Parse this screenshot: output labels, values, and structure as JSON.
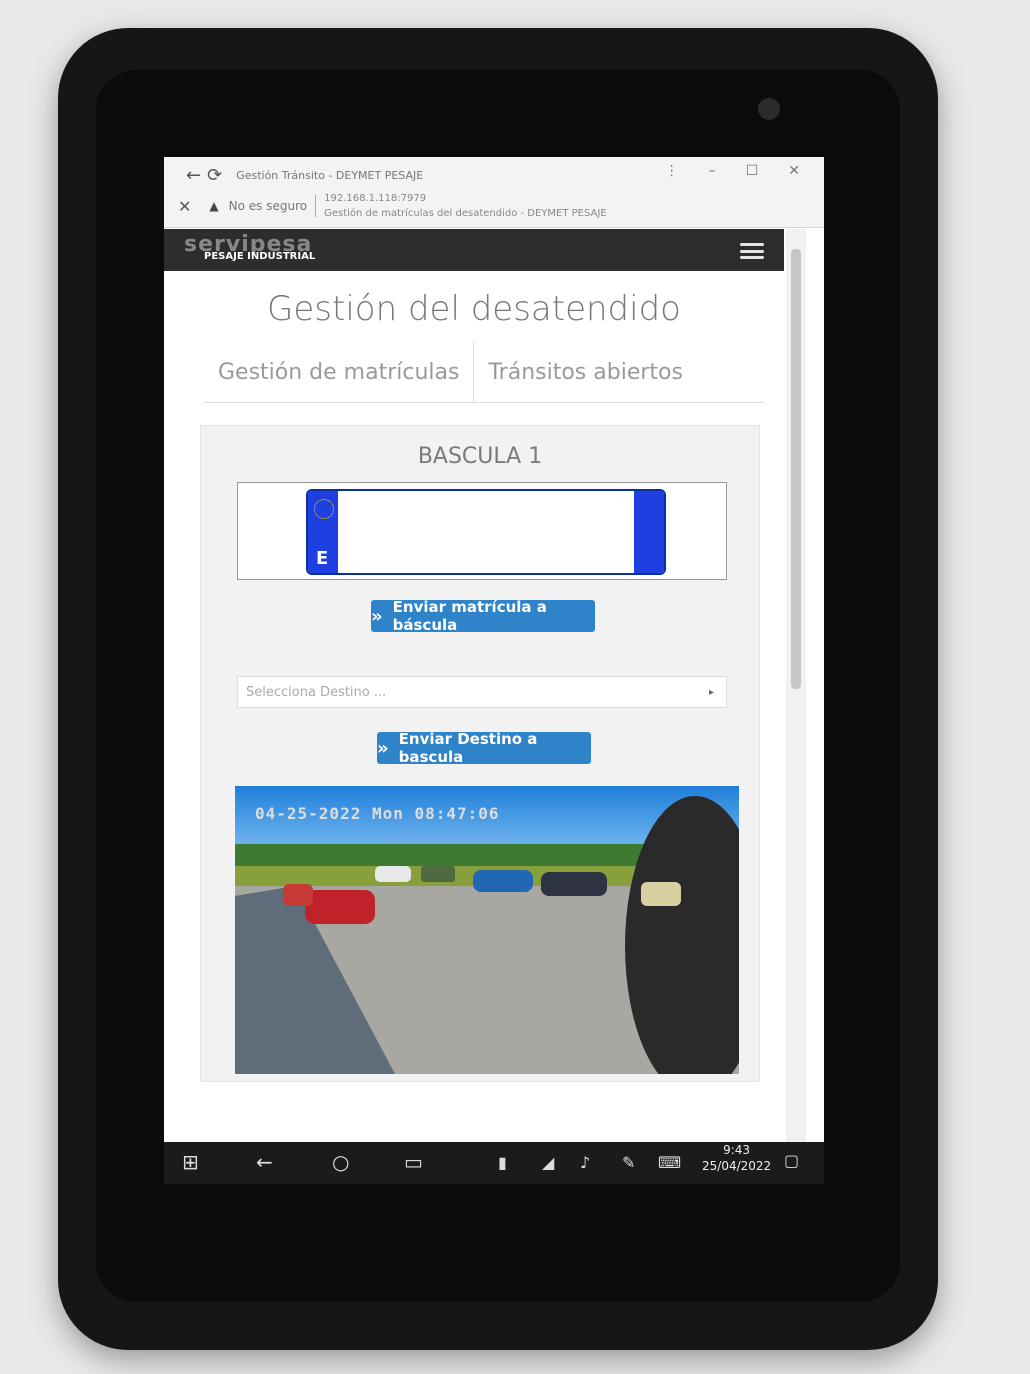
{
  "browser": {
    "tab_title": "Gestión Tránsito - DEYMET PESAJE",
    "security": "No es seguro",
    "url": "192.168.1.118:7979",
    "page_name": "Gestión de matrículas del desatendido - DEYMET PESAJE"
  },
  "app": {
    "brand": "servipesa",
    "brand_sub": "PESAJE INDUSTRIAL"
  },
  "page": {
    "title": "Gestión del desatendido",
    "tabs": [
      {
        "label": "Gestión de matrículas"
      },
      {
        "label": "Tránsitos abiertos"
      }
    ]
  },
  "scale": {
    "name": "BASCULA 1",
    "plate_country": "E",
    "plate_value": ""
  },
  "actions": {
    "send_plate": "Enviar matrícula a báscula",
    "destination_placeholder": "Selecciona Destino ...",
    "send_destination": "Enviar Destino a bascula"
  },
  "camera": {
    "timestamp": "04-25-2022 Mon 08:47:06"
  },
  "taskbar": {
    "time": "9:43",
    "date": "25/04/2022"
  },
  "colors": {
    "accent": "#2e83c9",
    "appbar": "#2d2d2d",
    "plate_blue": "#1e40e0"
  }
}
